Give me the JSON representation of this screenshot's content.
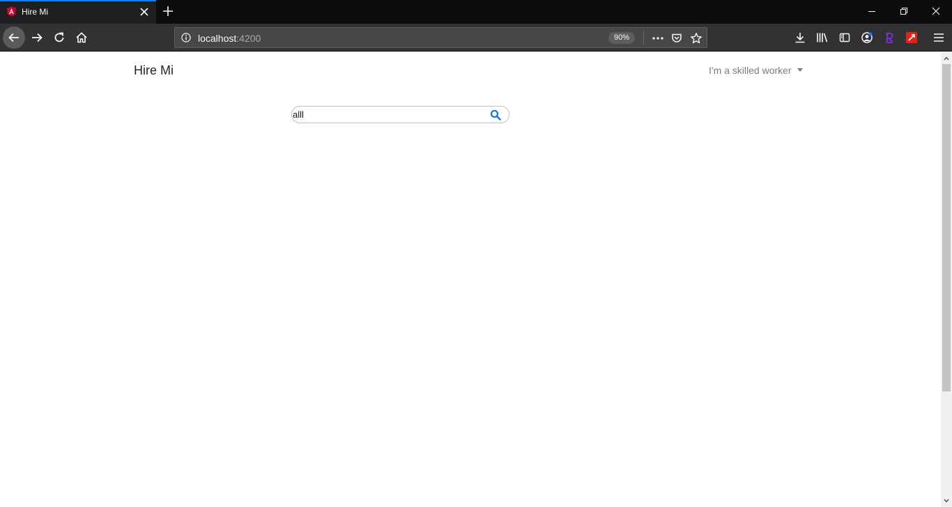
{
  "browser": {
    "tab": {
      "title": "Hire Mi"
    },
    "url": {
      "host": "localhost",
      "port": ":4200"
    },
    "zoom": "90%"
  },
  "app": {
    "brand": "Hire Mi",
    "role_menu": {
      "label": "I'm a skilled worker"
    },
    "search": {
      "value": "alll"
    }
  },
  "colors": {
    "accent": "#0a84ff",
    "search_icon": "#1a73e8",
    "angular_red": "#dd0031"
  }
}
